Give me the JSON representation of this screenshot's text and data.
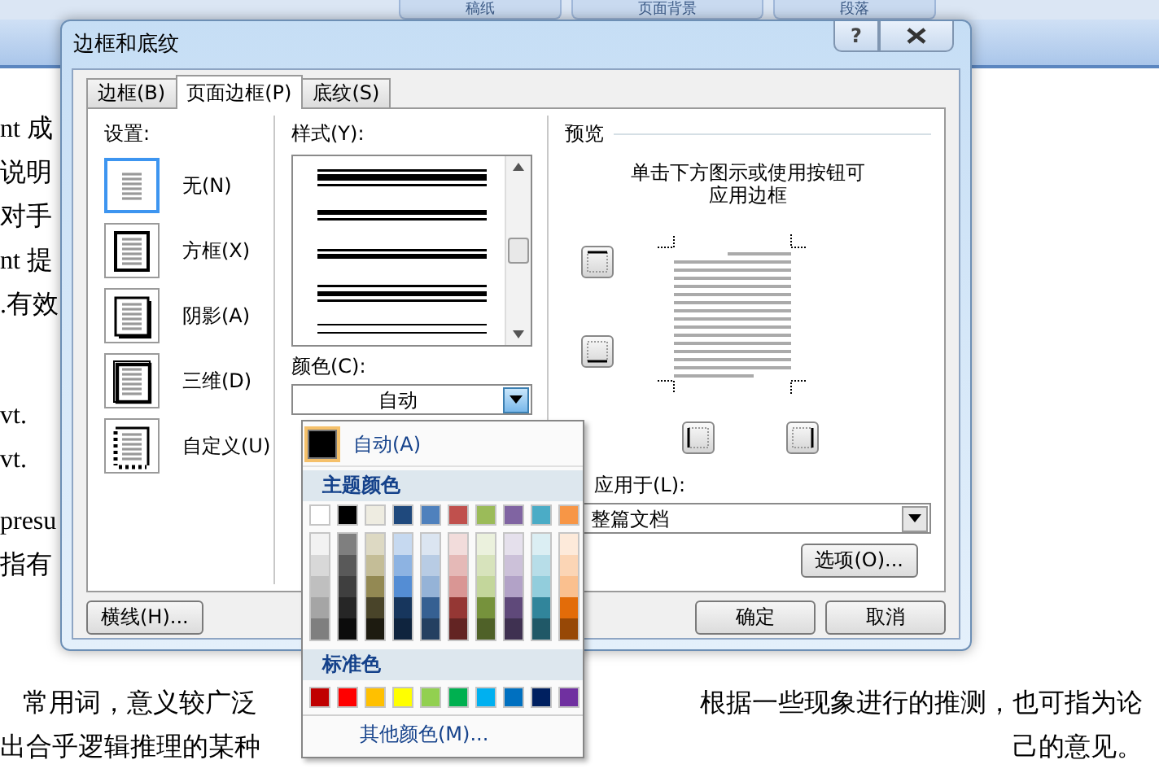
{
  "ribbon": {
    "groups": [
      "稿纸",
      "页面背景",
      "段落"
    ]
  },
  "document": {
    "lines": [
      {
        "left": "nt 成"
      },
      {
        "left": "说明"
      },
      {
        "left": "对手"
      },
      {
        "left": "nt 提"
      },
      {
        "left": ".有效"
      },
      {
        "left": "vt."
      },
      {
        "left": "vt."
      },
      {
        "left": "presu"
      },
      {
        "left": "指有"
      },
      {
        "left": "常用词，意义较广泛",
        "right": "根据一些现象进行的推测，也可指为论"
      },
      {
        "left": "出合乎逻辑推理的某种",
        "right": "己的意见。"
      }
    ]
  },
  "dialog": {
    "title": "边框和底纹",
    "help": "?",
    "tabs": [
      {
        "label": "边框(B)",
        "selected": false
      },
      {
        "label": "页面边框(P)",
        "selected": true
      },
      {
        "label": "底纹(S)",
        "selected": false
      }
    ],
    "settings": {
      "label": "设置:",
      "options": [
        {
          "label": "无(N)",
          "kind": "none",
          "selected": true
        },
        {
          "label": "方框(X)",
          "kind": "box",
          "selected": false
        },
        {
          "label": "阴影(A)",
          "kind": "shadow",
          "selected": false
        },
        {
          "label": "三维(D)",
          "kind": "threed",
          "selected": false
        },
        {
          "label": "自定义(U)",
          "kind": "custom",
          "selected": false
        }
      ]
    },
    "style": {
      "label": "样式(Y):"
    },
    "color": {
      "label": "颜色(C):",
      "value": "自动",
      "expanded": true
    },
    "preview": {
      "label": "预览",
      "instruction_lines": [
        "单击下方图示或使用按钮可",
        "应用边框"
      ]
    },
    "apply_to": {
      "label": "应用于(L):",
      "value": "整篇文档"
    },
    "options_button": "选项(O)...",
    "horizontal_line_button": "横线(H)...",
    "ok_button": "确定",
    "cancel_button": "取消"
  },
  "color_menu": {
    "automatic": {
      "label": "自动(A)",
      "color": "#000000",
      "selected": true
    },
    "theme_header": "主题颜色",
    "theme_colors": [
      {
        "color": "#ffffff",
        "shades": [
          {
            "color": "#f2f2f2"
          },
          {
            "color": "#d8d8d8"
          },
          {
            "color": "#bfbfbf"
          },
          {
            "color": "#a5a5a5"
          },
          {
            "color": "#7f7f7f"
          }
        ]
      },
      {
        "color": "#000000",
        "shades": [
          {
            "color": "#7f7f7f"
          },
          {
            "color": "#595959"
          },
          {
            "color": "#3f3f3f"
          },
          {
            "color": "#262626"
          },
          {
            "color": "#0c0c0c"
          }
        ]
      },
      {
        "color": "#eeece1",
        "shades": [
          {
            "color": "#ddd9c3"
          },
          {
            "color": "#c4bd97"
          },
          {
            "color": "#938953"
          },
          {
            "color": "#494429"
          },
          {
            "color": "#1d1b10"
          }
        ]
      },
      {
        "color": "#1f497d",
        "shades": [
          {
            "color": "#c6d9f0"
          },
          {
            "color": "#8db3e2"
          },
          {
            "color": "#548dd4"
          },
          {
            "color": "#17365d"
          },
          {
            "color": "#0f243e"
          }
        ]
      },
      {
        "color": "#4f81bd",
        "shades": [
          {
            "color": "#dbe5f1"
          },
          {
            "color": "#b8cce4"
          },
          {
            "color": "#95b3d7"
          },
          {
            "color": "#366092"
          },
          {
            "color": "#244061"
          }
        ]
      },
      {
        "color": "#c0504d",
        "shades": [
          {
            "color": "#f2dcdb"
          },
          {
            "color": "#e5b9b7"
          },
          {
            "color": "#d99694"
          },
          {
            "color": "#953734"
          },
          {
            "color": "#632423"
          }
        ]
      },
      {
        "color": "#9bbb59",
        "shades": [
          {
            "color": "#ebf1dd"
          },
          {
            "color": "#d7e3bc"
          },
          {
            "color": "#c3d69b"
          },
          {
            "color": "#76923c"
          },
          {
            "color": "#4f6128"
          }
        ]
      },
      {
        "color": "#8064a2",
        "shades": [
          {
            "color": "#e5e0ec"
          },
          {
            "color": "#ccc1d9"
          },
          {
            "color": "#b2a2c7"
          },
          {
            "color": "#5f497a"
          },
          {
            "color": "#3f3151"
          }
        ]
      },
      {
        "color": "#4bacc6",
        "shades": [
          {
            "color": "#dbeef3"
          },
          {
            "color": "#b7dde8"
          },
          {
            "color": "#92cddc"
          },
          {
            "color": "#31859b"
          },
          {
            "color": "#205867"
          }
        ]
      },
      {
        "color": "#f79646",
        "shades": [
          {
            "color": "#fdeada"
          },
          {
            "color": "#fbd5b5"
          },
          {
            "color": "#fac08f"
          },
          {
            "color": "#e36c09"
          },
          {
            "color": "#974806"
          }
        ]
      }
    ],
    "standard_header": "标准色",
    "standard_colors": [
      {
        "color": "#c00000"
      },
      {
        "color": "#ff0000"
      },
      {
        "color": "#ffc000"
      },
      {
        "color": "#ffff00"
      },
      {
        "color": "#92d050"
      },
      {
        "color": "#00b050"
      },
      {
        "color": "#00b0f0"
      },
      {
        "color": "#0070c0"
      },
      {
        "color": "#002060"
      },
      {
        "color": "#7030a0"
      }
    ],
    "more_colors": "其他颜色(M)..."
  }
}
